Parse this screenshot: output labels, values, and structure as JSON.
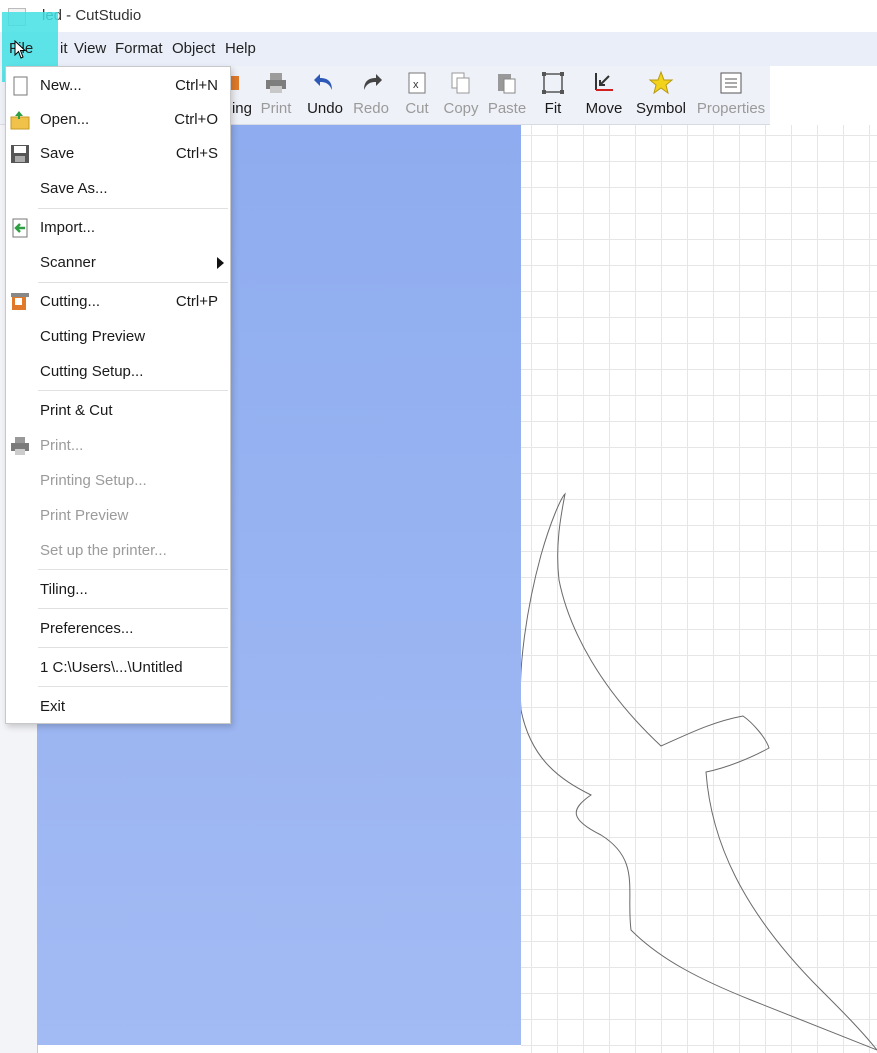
{
  "window": {
    "title": "led - CutStudio"
  },
  "menubar": {
    "file": "File",
    "edit": "it",
    "view": "View",
    "format": "Format",
    "object": "Object",
    "help": "Help"
  },
  "toolbar": {
    "cutting": "ing",
    "print": "Print",
    "undo": "Undo",
    "redo": "Redo",
    "cut": "Cut",
    "copy": "Copy",
    "paste": "Paste",
    "fit": "Fit",
    "move": "Move",
    "symbol": "Symbol",
    "properties": "Properties"
  },
  "file_menu": {
    "new": {
      "label": "New...",
      "shortcut": "Ctrl+N"
    },
    "open": {
      "label": "Open...",
      "shortcut": "Ctrl+O"
    },
    "save": {
      "label": "Save",
      "shortcut": "Ctrl+S"
    },
    "save_as": {
      "label": "Save As..."
    },
    "import": {
      "label": "Import..."
    },
    "scanner": {
      "label": "Scanner"
    },
    "cutting": {
      "label": "Cutting...",
      "shortcut": "Ctrl+P"
    },
    "cutting_preview": {
      "label": "Cutting Preview"
    },
    "cutting_setup": {
      "label": "Cutting Setup..."
    },
    "print_cut": {
      "label": "Print & Cut"
    },
    "print": {
      "label": "Print..."
    },
    "printing_setup": {
      "label": "Printing Setup..."
    },
    "print_preview": {
      "label": "Print Preview"
    },
    "setup_printer": {
      "label": "Set up the printer..."
    },
    "tiling": {
      "label": "Tiling..."
    },
    "preferences": {
      "label": "Preferences..."
    },
    "recent_file": {
      "label": "1 C:\\Users\\...\\Untitled"
    },
    "exit": {
      "label": "Exit"
    }
  },
  "colors": {
    "accent": "#43e0e4",
    "canvas_blue": "#95b1f0",
    "menubar": "#e9eef9"
  }
}
